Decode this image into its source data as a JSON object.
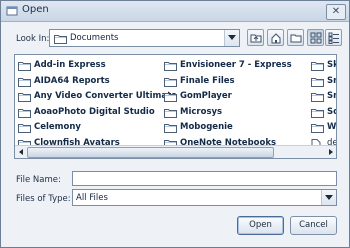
{
  "window": {
    "title": "Open",
    "close_glyph": "✕"
  },
  "lookin": {
    "label": "Look In:",
    "value": "Documents"
  },
  "toolbar": {
    "buttons": [
      {
        "name": "up-one-level-icon"
      },
      {
        "name": "home-icon"
      },
      {
        "name": "new-folder-icon"
      },
      {
        "name": "list-view-icon",
        "pressed": true
      },
      {
        "name": "details-view-icon"
      }
    ]
  },
  "files": {
    "col1": [
      "Add-in Express",
      "AIDA64 Reports",
      "Any Video Converter Ultimate",
      "AoaoPhoto Digital Studio",
      "Celemony",
      "Clownfish Avatars"
    ],
    "col2": [
      "Envisioneer 7 - Express",
      "Finale Files",
      "GomPlayer",
      "Microsys",
      "Mobogenie",
      "OneNote Notebooks"
    ],
    "col3": [
      "Sky",
      "Sm",
      "Sm",
      "Soc",
      "We",
      "dela"
    ]
  },
  "filename": {
    "label": "File Name:",
    "value": ""
  },
  "filetype": {
    "label": "Files of Type:",
    "value": "All Files"
  },
  "buttons": {
    "open": "Open",
    "cancel": "Cancel"
  }
}
